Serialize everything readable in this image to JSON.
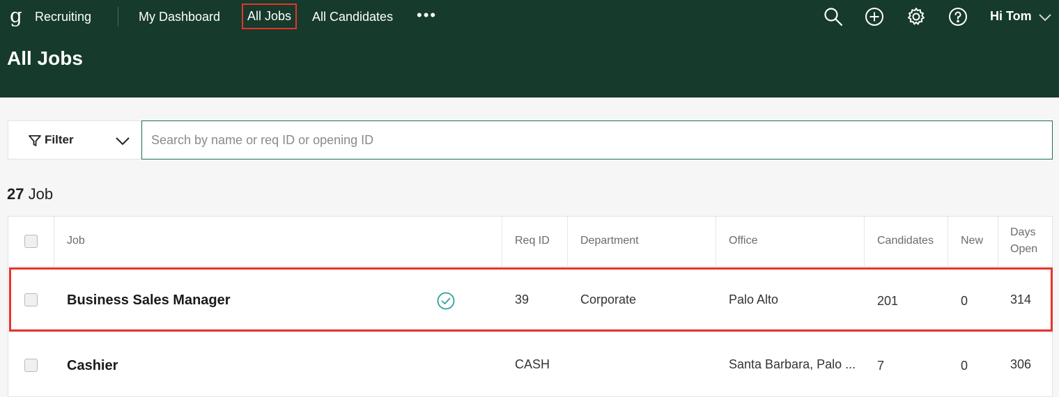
{
  "nav": {
    "logo": "g",
    "product": "Recruiting",
    "items": [
      "My Dashboard",
      "All Jobs",
      "All Candidates"
    ],
    "more": "•••",
    "greeting": "Hi Tom",
    "active_item": "All Jobs"
  },
  "page": {
    "title": "All Jobs"
  },
  "filter": {
    "label": "Filter",
    "search_placeholder": "Search by name or req ID or opening ID",
    "search_value": ""
  },
  "summary": {
    "count": "27",
    "unit": "Job"
  },
  "table": {
    "headers": {
      "job": "Job",
      "req_id": "Req ID",
      "department": "Department",
      "office": "Office",
      "candidates": "Candidates",
      "new": "New",
      "days_open_line1": "Days",
      "days_open_line2": "Open"
    },
    "rows": [
      {
        "job": "Business Sales Manager",
        "req_id": "39",
        "department": "Corporate",
        "office": "Palo Alto",
        "candidates": "201",
        "new": "0",
        "days_open": "314",
        "status_icon": "check-circle-icon",
        "highlighted": true
      },
      {
        "job": "Cashier",
        "req_id": "CASH",
        "department": "",
        "office": "Santa Barbara, Palo ...",
        "candidates": "7",
        "new": "0",
        "days_open": "306",
        "highlighted": false
      }
    ]
  },
  "colors": {
    "header_bg": "#163a2b",
    "highlight": "#e8332a",
    "accent_teal": "#2aa39a",
    "search_border": "#1f6e4f"
  }
}
